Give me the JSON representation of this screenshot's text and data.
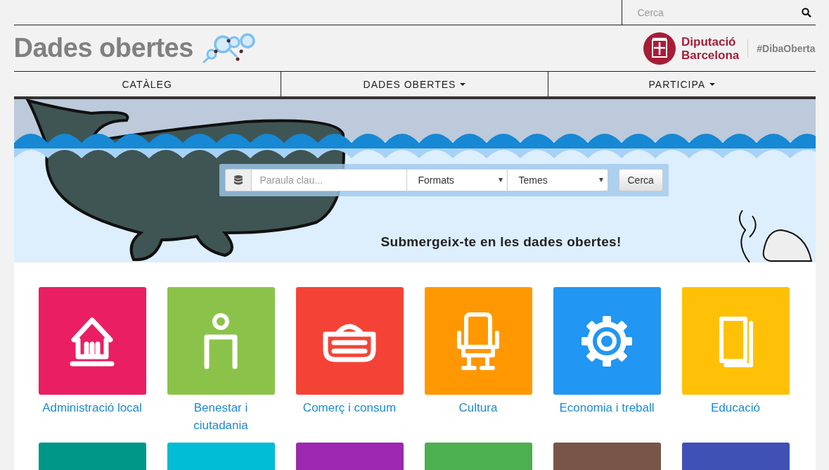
{
  "top_search": {
    "placeholder": "Cerca"
  },
  "header": {
    "title": "Dades obertes",
    "brand_line_1": "Diputació",
    "brand_line_2": "Barcelona",
    "hashtag": "#DibaOberta"
  },
  "nav": [
    {
      "label": "CATÀLEG",
      "dropdown": false
    },
    {
      "label": "DADES OBERTES",
      "dropdown": true
    },
    {
      "label": "PARTICIPA",
      "dropdown": true
    }
  ],
  "banner": {
    "keyword_placeholder": "Paraula clau...",
    "format_select": "Formats",
    "theme_select": "Temes",
    "button": "Cerca",
    "tagline": "Submergeix-te en les dades obertes!"
  },
  "categories": [
    {
      "label": "Administració local",
      "color": "#e91e63",
      "kind": "building"
    },
    {
      "label": "Benestar i ciutadania",
      "color": "#8bc34a",
      "kind": "person"
    },
    {
      "label": "Comerç i consum",
      "color": "#f44336",
      "kind": "basket"
    },
    {
      "label": "Cultura",
      "color": "#ff9800",
      "kind": "chair"
    },
    {
      "label": "Economia i treball",
      "color": "#2196f3",
      "kind": "gear"
    },
    {
      "label": "Educació",
      "color": "#ffc107",
      "kind": "book"
    },
    {
      "color": "#009688"
    },
    {
      "color": "#00bcd4"
    },
    {
      "color": "#9c27b0"
    },
    {
      "color": "#4caf50"
    },
    {
      "color": "#795548"
    },
    {
      "color": "#3f51b5"
    }
  ]
}
